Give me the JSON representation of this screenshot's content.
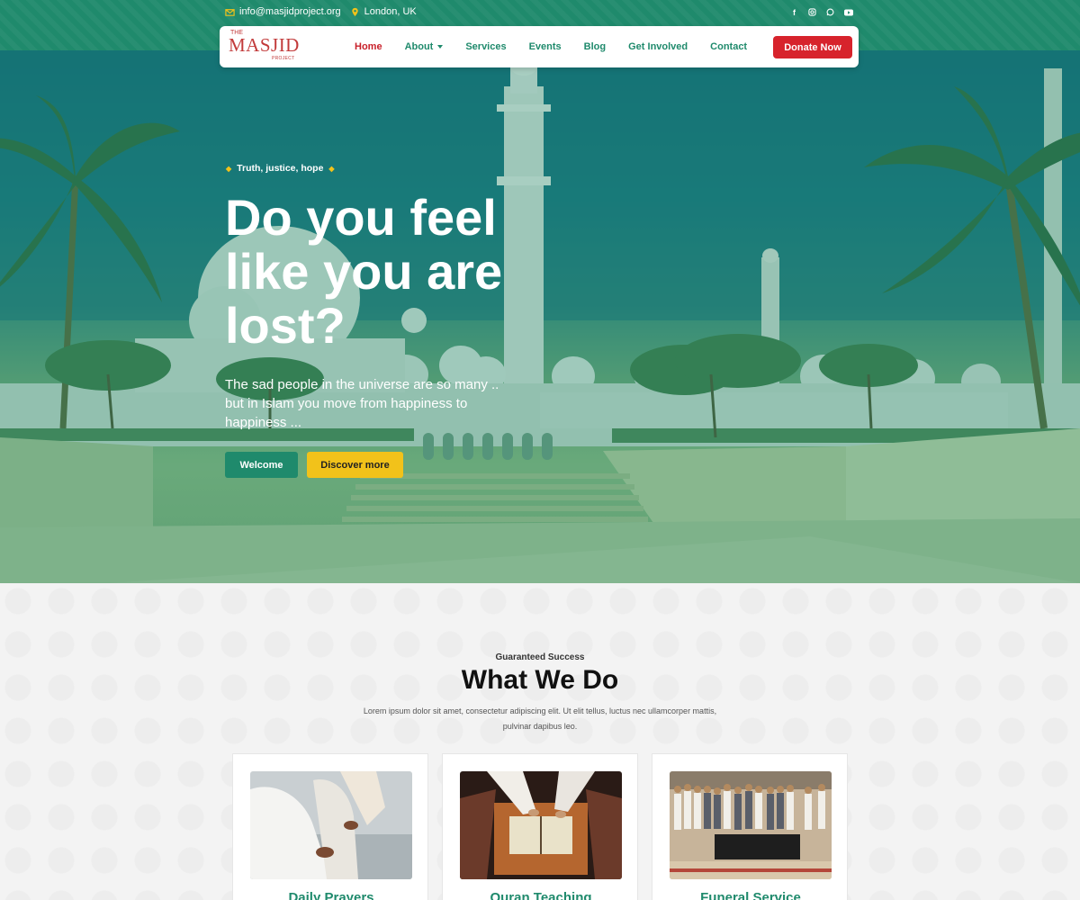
{
  "topbar": {
    "email": "info@masjidproject.org",
    "location": "London, UK",
    "socials": [
      "facebook-icon",
      "instagram-icon",
      "whatsapp-icon",
      "youtube-icon"
    ]
  },
  "logo": {
    "the": "THE",
    "word": "MASJID",
    "sub": "PROJECT"
  },
  "nav": {
    "items": [
      {
        "label": "Home",
        "active": true
      },
      {
        "label": "About",
        "dropdown": true
      },
      {
        "label": "Services"
      },
      {
        "label": "Events"
      },
      {
        "label": "Blog"
      },
      {
        "label": "Get Involved"
      },
      {
        "label": "Contact"
      }
    ],
    "donate_label": "Donate Now"
  },
  "hero": {
    "tagline": "Truth, justice, hope",
    "headline": "Do you feel like you are lost?",
    "subtext": "The sad people in the universe are so many .. but in Islam you move from happiness to happiness ...",
    "welcome_label": "Welcome",
    "discover_label": "Discover more"
  },
  "section": {
    "eyebrow": "Guaranteed Success",
    "title": "What We Do",
    "description": "Lorem ipsum dolor sit amet, consectetur adipiscing elit. Ut elit tellus, luctus nec ullamcorper mattis, pulvinar dapibus leo.",
    "cards": [
      {
        "title": "Daily Prayers"
      },
      {
        "title": "Quran Teaching"
      },
      {
        "title": "Funeral Service"
      }
    ]
  },
  "colors": {
    "primary": "#1f8a6c",
    "accent": "#d7232c",
    "yellow": "#f2c21a"
  }
}
